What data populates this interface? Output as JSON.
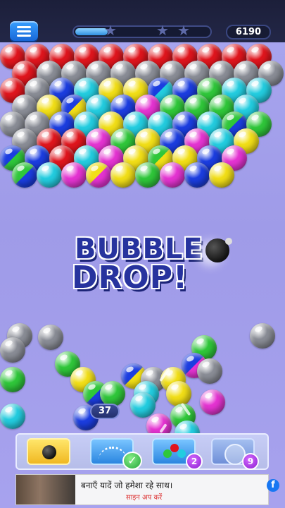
{
  "hud": {
    "score": "6190",
    "star_icons": [
      "star-icon",
      "star-icon",
      "star-icon"
    ],
    "progress_fraction": 0.24
  },
  "title": {
    "line1": "BUBBLE",
    "line2": "DROP!"
  },
  "shooter": {
    "shots_left": "37"
  },
  "tools": {
    "bomb_icon": "bomb-icon",
    "aim_icon": "aim-guide-icon",
    "aim_ready_icon": "check-icon",
    "color_icon": "color-bubbles-icon",
    "color_count": "2",
    "swap_icon": "swap-bubble-icon",
    "swap_count": "9"
  },
  "ad": {
    "headline": "बनाएँ यादें जो हमेशा रहे साथ।",
    "cta": "साइन अप करें",
    "brand_icon": "f"
  },
  "colors": {
    "red": "#e0151d",
    "gray": "#8a8d96",
    "blue": "#1b3de0",
    "cyan": "#23cde0",
    "yellow": "#f2df17",
    "green": "#2fc73a",
    "magenta": "#e533d2"
  }
}
